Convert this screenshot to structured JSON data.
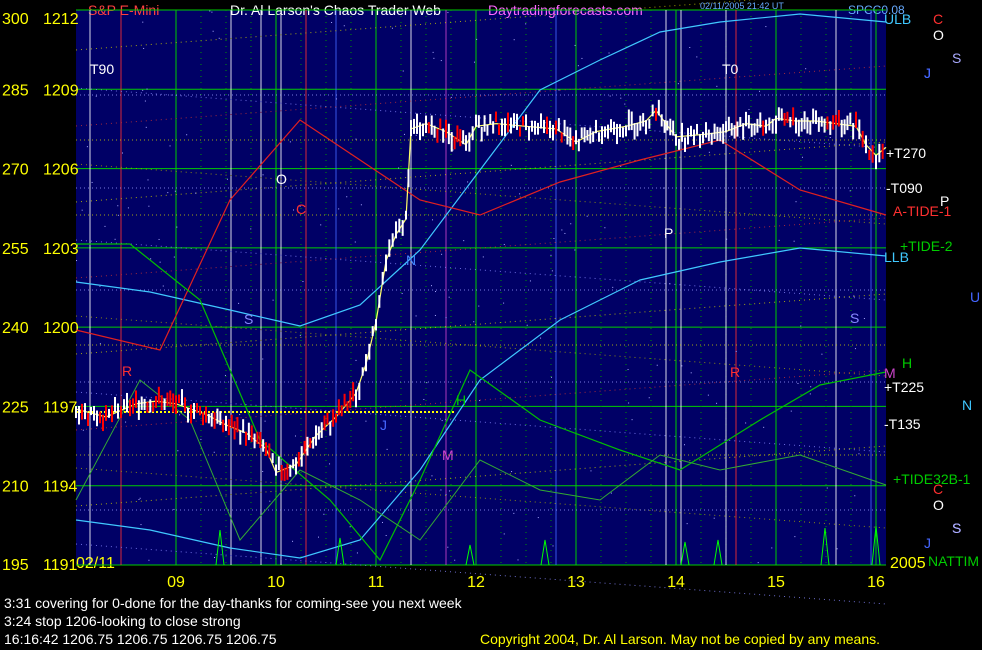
{
  "header": {
    "symbol": "S&P E-Mini",
    "title": "Dr. Al Larson's Chaos Trader Web",
    "website": "Daytradingforecasts.com",
    "timestamp": "02/11/2005 21:42 UT",
    "top_right": "SPCC0.08",
    "corner_letters": [
      "C",
      "O",
      "S",
      "J"
    ]
  },
  "colors": {
    "background": "#000000",
    "plot_background": "#000066",
    "price_bars": "#ffffff",
    "down_bars": "#ff0000",
    "grid": "#00cc00",
    "axis_labels": "#ffff00",
    "cyan": "#40c8ff",
    "red": "#e02020",
    "green": "#00c000",
    "magenta": "#cc44cc"
  },
  "chart_data": {
    "type": "line",
    "title": "S&P E-Mini",
    "date_label": "02/11",
    "year_label": "2005",
    "x_ticks": [
      "09",
      "10",
      "11",
      "12",
      "13",
      "14",
      "15",
      "16"
    ],
    "x_range": [
      8.0,
      16.1
    ],
    "y_left_ticks": [
      195,
      210,
      225,
      240,
      255,
      270,
      285,
      300
    ],
    "y_price_ticks": [
      1191,
      1194,
      1197,
      1200,
      1203,
      1206,
      1209,
      1212
    ],
    "y_range": [
      1191,
      1212
    ],
    "series": [
      {
        "name": "S&P E-Mini",
        "type": "price",
        "x": [
          8.0,
          8.3,
          8.6,
          8.8,
          9.0,
          9.3,
          9.5,
          9.7,
          9.9,
          10.0,
          10.2,
          10.4,
          10.6,
          10.8,
          10.9,
          11.0,
          11.1,
          11.2,
          11.3,
          11.35,
          11.5,
          11.7,
          11.9,
          12.0,
          12.2,
          12.5,
          12.8,
          13.0,
          13.2,
          13.5,
          13.7,
          13.8,
          14.0,
          14.3,
          14.5,
          14.7,
          14.9,
          15.0,
          15.2,
          15.4,
          15.6,
          15.8,
          15.9,
          16.0,
          16.1
        ],
        "y": [
          1196.9,
          1196.6,
          1197.1,
          1197.2,
          1197.1,
          1196.7,
          1196.3,
          1196.0,
          1195.4,
          1194.5,
          1194.8,
          1195.9,
          1196.6,
          1197.5,
          1198.6,
          1200.2,
          1202.5,
          1203.5,
          1204.1,
          1207.5,
          1207.7,
          1207.4,
          1206.9,
          1207.6,
          1207.7,
          1207.6,
          1207.5,
          1207.0,
          1207.4,
          1207.6,
          1207.8,
          1208.2,
          1207.2,
          1207.3,
          1207.4,
          1207.7,
          1207.6,
          1207.9,
          1207.8,
          1207.8,
          1207.7,
          1207.6,
          1206.9,
          1206.5,
          1206.8
        ]
      }
    ],
    "right_labels": [
      "ULB",
      "+T270",
      "-T090",
      "A-TIDE-1",
      "+TIDE-2",
      "LLB",
      "H",
      "M",
      "+T225",
      "-T135",
      "+TIDE32B-1",
      "NATTIM"
    ],
    "right_margin_letters": [
      "S",
      "J",
      "P",
      "U",
      "N",
      "S",
      "J"
    ],
    "plot_letters": [
      "T90",
      "O",
      "C",
      "S",
      "N",
      "P",
      "T0",
      "R",
      "H",
      "M",
      "J",
      "R",
      "S"
    ]
  },
  "footer": {
    "line1": "3:31 covering for 0-done for the day-thanks for coming-see you next week",
    "line2": "3:24 stop 1206-looking to close strong",
    "line3": "16:16:42   1206.75  1206.75  1206.75  1206.75",
    "copyright": "Copyright 2004, Dr. Al Larson. May not be copied by any means."
  }
}
